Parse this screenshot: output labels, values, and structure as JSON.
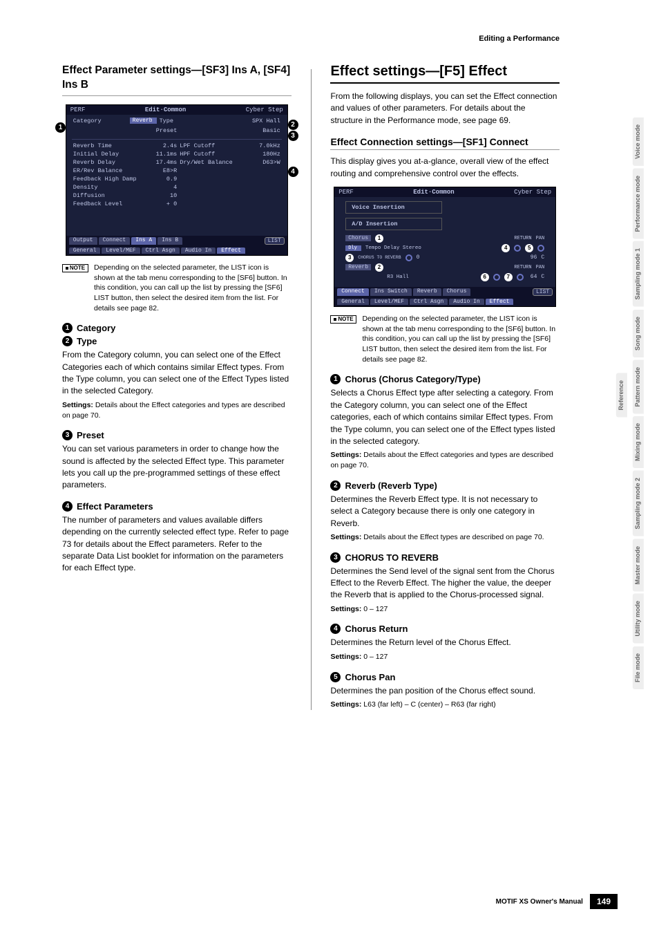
{
  "header": {
    "section": "Editing a Performance"
  },
  "left": {
    "h2": "Effect Parameter settings—[SF3] Ins A, [SF4] Ins B",
    "screenshot": {
      "title_left": "PERF",
      "title_mid": "Edit·Common",
      "title_right": "Cyber Step",
      "top": {
        "category_label": "Category",
        "category_value": "Reverb",
        "type_label": "Type",
        "type_value": "SPX Hall",
        "preset_label": "Preset",
        "preset_value": "Basic"
      },
      "params": [
        {
          "l": "Reverb Time",
          "v": "2.4s",
          "l2": "LPF Cutoff",
          "v2": "7.0kHz"
        },
        {
          "l": "Initial Delay",
          "v": "11.1ms",
          "l2": "HPF Cutoff",
          "v2": "180Hz"
        },
        {
          "l": "Reverb Delay",
          "v": "17.4ms",
          "l2": "Dry/Wet Balance",
          "v2": "D63>W"
        },
        {
          "l": "ER/Rev Balance",
          "v": "E8>R",
          "l2": "",
          "v2": ""
        },
        {
          "l": "Feedback High Damp",
          "v": "0.9",
          "l2": "",
          "v2": ""
        },
        {
          "l": "Density",
          "v": "4",
          "l2": "",
          "v2": ""
        },
        {
          "l": "Diffusion",
          "v": "10",
          "l2": "",
          "v2": ""
        },
        {
          "l": "Feedback Level",
          "v": "+ 0",
          "l2": "",
          "v2": ""
        }
      ],
      "tabs_upper": [
        "Output",
        "Connect",
        "Ins A",
        "Ins B"
      ],
      "list_btn": "LIST",
      "tabs_lower": [
        "General",
        "Level/MEF",
        "Ctrl Asgn",
        "Audio In",
        "Effect"
      ]
    },
    "note_tag": "NOTE",
    "note_text": "Depending on the selected parameter, the LIST icon is shown at the tab menu corresponding to the [SF6] button. In this condition, you can call up the list by pressing the [SF6] LIST button, then select the desired item from the list. For details see page 82.",
    "p1_title": "Category",
    "p2_title": "Type",
    "p12_body": "From the Category column, you can select one of the Effect Categories each of which contains similar Effect types. From the Type column, you can select one of the Effect Types listed in the selected Category.",
    "p12_settings": "Details about the Effect categories and types are described on page 70.",
    "p3_title": "Preset",
    "p3_body": "You can set various parameters in order to change how the sound is affected by the selected Effect type. This parameter lets you call up the pre-programmed settings of these effect parameters.",
    "p4_title": "Effect Parameters",
    "p4_body": "The number of parameters and values available differs depending on the currently selected effect type. Refer to page 73 for details about the Effect parameters. Refer to the separate Data List booklet for information on the parameters for each Effect type."
  },
  "right": {
    "h1": "Effect settings—[F5] Effect",
    "intro": "From the following displays, you can set the Effect connection and values of other parameters. For details about the structure in the Performance mode, see page 69.",
    "sub_h": "Effect Connection settings—[SF1] Connect",
    "sub_intro": "This display gives you at-a-glance, overall view of the effect routing and comprehensive control over the effects.",
    "screenshot": {
      "title_left": "PERF",
      "title_mid": "Edit·Common",
      "title_right": "Cyber Step",
      "box1": "Voice Insertion",
      "box2": "A/D Insertion",
      "chorus_label": "Chorus",
      "chorus_cat": "Dly",
      "chorus_type": "Tempo Delay Stereo",
      "send_label": "CHORUS TO REVERB",
      "send_val": "0",
      "return_label": "RETURN",
      "pan_label": "PAN",
      "ret1": "96",
      "pan1": "C",
      "reverb_label": "Reverb",
      "reverb_type": "R3 Hall",
      "ret2": "64",
      "pan2": "C",
      "tabs_upper": [
        "Connect",
        "Ins Switch",
        "Reverb",
        "Chorus"
      ],
      "list_btn": "LIST",
      "tabs_lower": [
        "General",
        "Level/MEF",
        "Ctrl Asgn",
        "Audio In",
        "Effect"
      ]
    },
    "note_tag": "NOTE",
    "note_text": "Depending on the selected parameter, the LIST icon is shown at the tab menu corresponding to the [SF6] button. In this condition, you can call up the list by pressing the [SF6] LIST button, then select the desired item from the list. For details see page 82.",
    "p1_title": "Chorus (Chorus Category/Type)",
    "p1_body": "Selects a Chorus Effect type after selecting a category. From the Category column, you can select one of the Effect categories, each of which contains similar Effect types. From the Type column, you can select one of the Effect types listed in the selected category.",
    "p1_settings": "Details about the Effect categories and types are described on page 70.",
    "p2_title": "Reverb (Reverb Type)",
    "p2_body": "Determines the Reverb Effect type. It is not necessary to select a Category because there is only one category in Reverb.",
    "p2_settings": "Details about the Effect types are described on page 70.",
    "p3_title": "CHORUS TO REVERB",
    "p3_body": "Determines the Send level of the signal sent from the Chorus Effect to the Reverb Effect. The higher the value, the deeper the Reverb that is applied to the Chorus-processed signal.",
    "p3_settings": "0 – 127",
    "p4_title": "Chorus Return",
    "p4_body": "Determines the Return level of the Chorus Effect.",
    "p4_settings": "0 – 127",
    "p5_title": "Chorus Pan",
    "p5_body": "Determines the pan position of the Chorus effect sound.",
    "p5_settings": "L63 (far left) – C (center) – R63 (far right)"
  },
  "sidetabs": [
    "Voice mode",
    "Performance mode",
    "Sampling mode 1",
    "Song mode",
    "Pattern mode",
    "Mixing mode",
    "Sampling mode 2",
    "Master mode",
    "Utility mode",
    "File mode"
  ],
  "sidetab_ref": "Reference",
  "footer": {
    "book": "MOTIF XS Owner's Manual",
    "page": "149"
  },
  "settings_label": "Settings:"
}
